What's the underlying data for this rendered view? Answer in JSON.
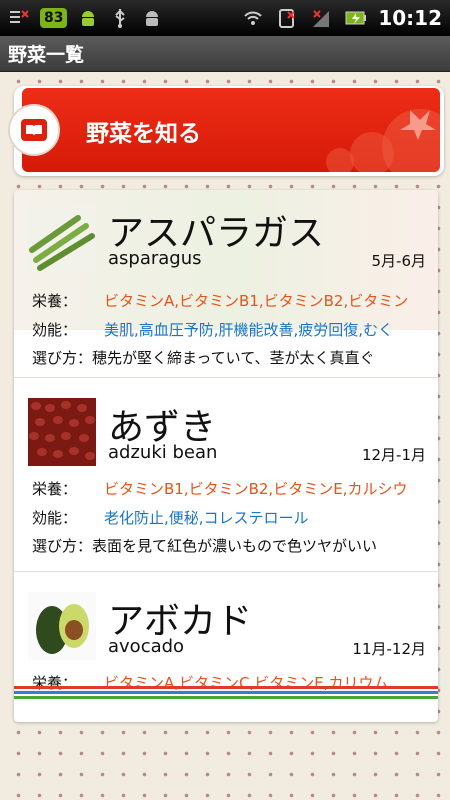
{
  "status_bar": {
    "battery_badge": "83",
    "time": "10:12"
  },
  "title_bar": {
    "title": "野菜一覧"
  },
  "banner": {
    "label": "野菜を知る"
  },
  "items": [
    {
      "jp_name": "アスパラガス",
      "en_name": "asparagus",
      "season": "5月-6月",
      "nutrition_label": "栄養：",
      "nutrition": "ビタミンA,ビタミンB1,ビタミンB2,ビタミン",
      "effect_label": "効能：",
      "effect": "美肌,高血圧予防,肝機能改善,疲労回復,むく",
      "choose_label": "選び方：",
      "choose": "穂先が堅く締まっていて、茎が太く真直ぐ"
    },
    {
      "jp_name": "あずき",
      "en_name": "adzuki bean",
      "season": "12月-1月",
      "nutrition_label": "栄養：",
      "nutrition": "ビタミンB1,ビタミンB2,ビタミンE,カルシウ",
      "effect_label": "効能：",
      "effect": "老化防止,便秘,コレステロール",
      "choose_label": "選び方：",
      "choose": "表面を見て紅色が濃いもので色ツヤがいい"
    },
    {
      "jp_name": "アボカド",
      "en_name": "avocado",
      "season": "11月-12月",
      "nutrition_label": "栄養：",
      "nutrition": "ビタミンA,ビタミンC,ビタミンE,カリウム"
    }
  ],
  "colors": {
    "banner_red": "#e32a13",
    "nutrition_orange": "#e8531a",
    "effect_blue": "#1a74c8"
  }
}
